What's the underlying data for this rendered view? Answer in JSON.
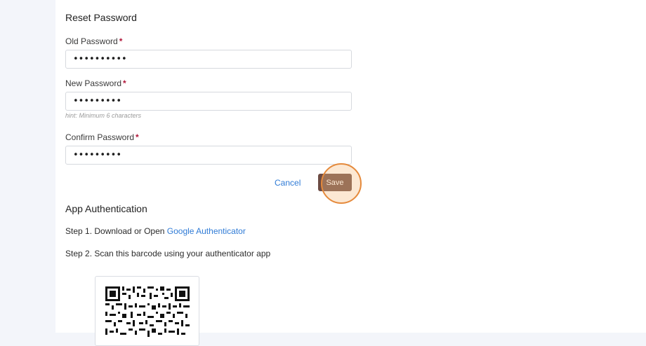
{
  "reset_password": {
    "title": "Reset Password",
    "old_password": {
      "label": "Old Password",
      "required_mark": "*",
      "value": "••••••••••"
    },
    "new_password": {
      "label": "New Password",
      "required_mark": "*",
      "value": "•••••••••",
      "hint": "hint: Minimum 6 characters"
    },
    "confirm_password": {
      "label": "Confirm Password",
      "required_mark": "*",
      "value": "•••••••••"
    },
    "cancel_label": "Cancel",
    "save_label": "Save"
  },
  "app_auth": {
    "title": "App Authentication",
    "step1_prefix": "Step 1. Download or Open ",
    "step1_link": "Google Authenticator",
    "step2": "Step 2. Scan this barcode using your authenticator app"
  },
  "colors": {
    "sidebar_bg": "#f3f5fa",
    "link": "#2f7bd6",
    "save_button": "#6c4b43",
    "required": "#b0173a",
    "click_highlight": "#e58a3c"
  },
  "icons": {
    "qr": "qr-code-icon"
  }
}
